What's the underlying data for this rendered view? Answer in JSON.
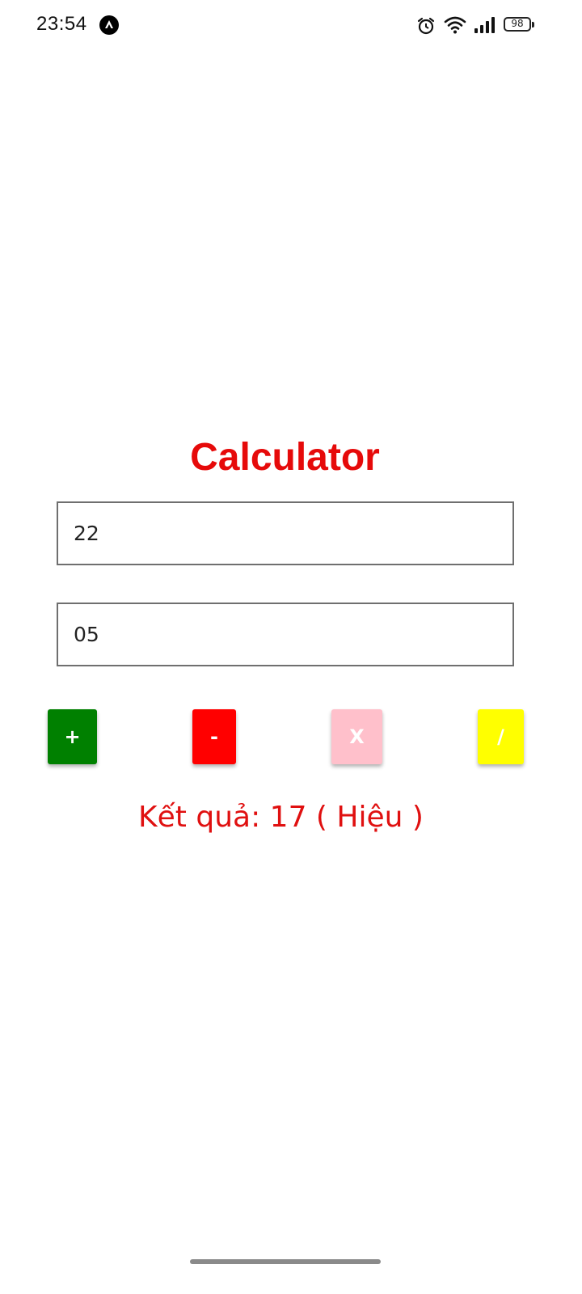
{
  "status_bar": {
    "time": "23:54",
    "battery": "98",
    "icons": [
      "app-notification-icon",
      "alarm-icon",
      "wifi-icon",
      "signal-icon",
      "battery-icon"
    ]
  },
  "calculator": {
    "title": "Calculator",
    "input_a": "22",
    "input_b": "05",
    "buttons": {
      "add": "+",
      "subtract": "-",
      "multiply": "X",
      "divide": "/"
    },
    "result": "Kết quả: 17 ( Hiệu )"
  },
  "colors": {
    "title": "#e60a0a",
    "add_button": "#008000",
    "subtract_button": "#ff0000",
    "multiply_button": "#ffc0cb",
    "divide_button": "#ffff00",
    "result_text": "#e01010"
  }
}
